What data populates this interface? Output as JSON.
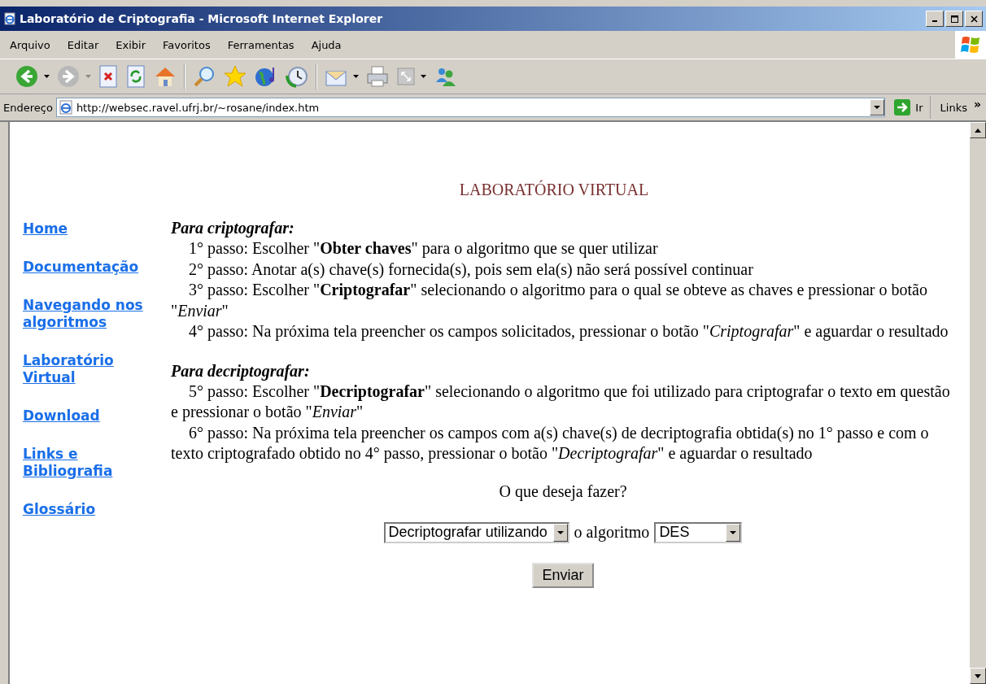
{
  "window": {
    "title": "Laboratório de Criptografia - Microsoft Internet Explorer"
  },
  "menu": [
    "Arquivo",
    "Editar",
    "Exibir",
    "Favoritos",
    "Ferramentas",
    "Ajuda"
  ],
  "address": {
    "label": "Endereço",
    "url": "http://websec.ravel.ufrj.br/~rosane/index.htm",
    "go": "Ir",
    "links": "Links",
    "links_more": "»"
  },
  "page": {
    "heading": "LABORATÓRIO VIRTUAL",
    "nav": [
      "Home",
      "Documentação",
      "Navegando nos algoritmos",
      "Laboratório Virtual",
      "Download",
      "Links e Bibliografia",
      "Glossário"
    ],
    "sections": [
      {
        "title": "Para criptografar:",
        "steps": [
          "1° passo: Escolher \"**Obter chaves**\" para o algoritmo que se quer utilizar",
          "2° passo: Anotar a(s) chave(s) fornecida(s), pois sem ela(s) não será possível continuar",
          "3° passo: Escolher \"**Criptografar**\" selecionando o algoritmo para o qual se obteve as chaves e pressionar o botão \"*Enviar*\"",
          "4° passo: Na próxima tela preencher os campos solicitados, pressionar o botão \"*Criptografar*\" e aguardar o resultado"
        ]
      },
      {
        "title": "Para decriptografar:",
        "steps": [
          "5° passo: Escolher \"**Decriptografar**\" selecionando o algoritmo que foi utilizado para criptografar o texto em questão e pressionar o botão \"*Enviar*\"",
          "6° passo: Na próxima tela preencher os campos com a(s) chave(s) de decriptografia obtida(s) no 1° passo e com o texto criptografado obtido no 4° passo, pressionar o botão \"*Decriptografar*\" e aguardar o resultado"
        ]
      }
    ],
    "question": "O que deseja fazer?",
    "action_select": "Decriptografar utilizando",
    "connector": "o algoritmo",
    "algorithm_select": "DES",
    "submit": "Enviar"
  }
}
